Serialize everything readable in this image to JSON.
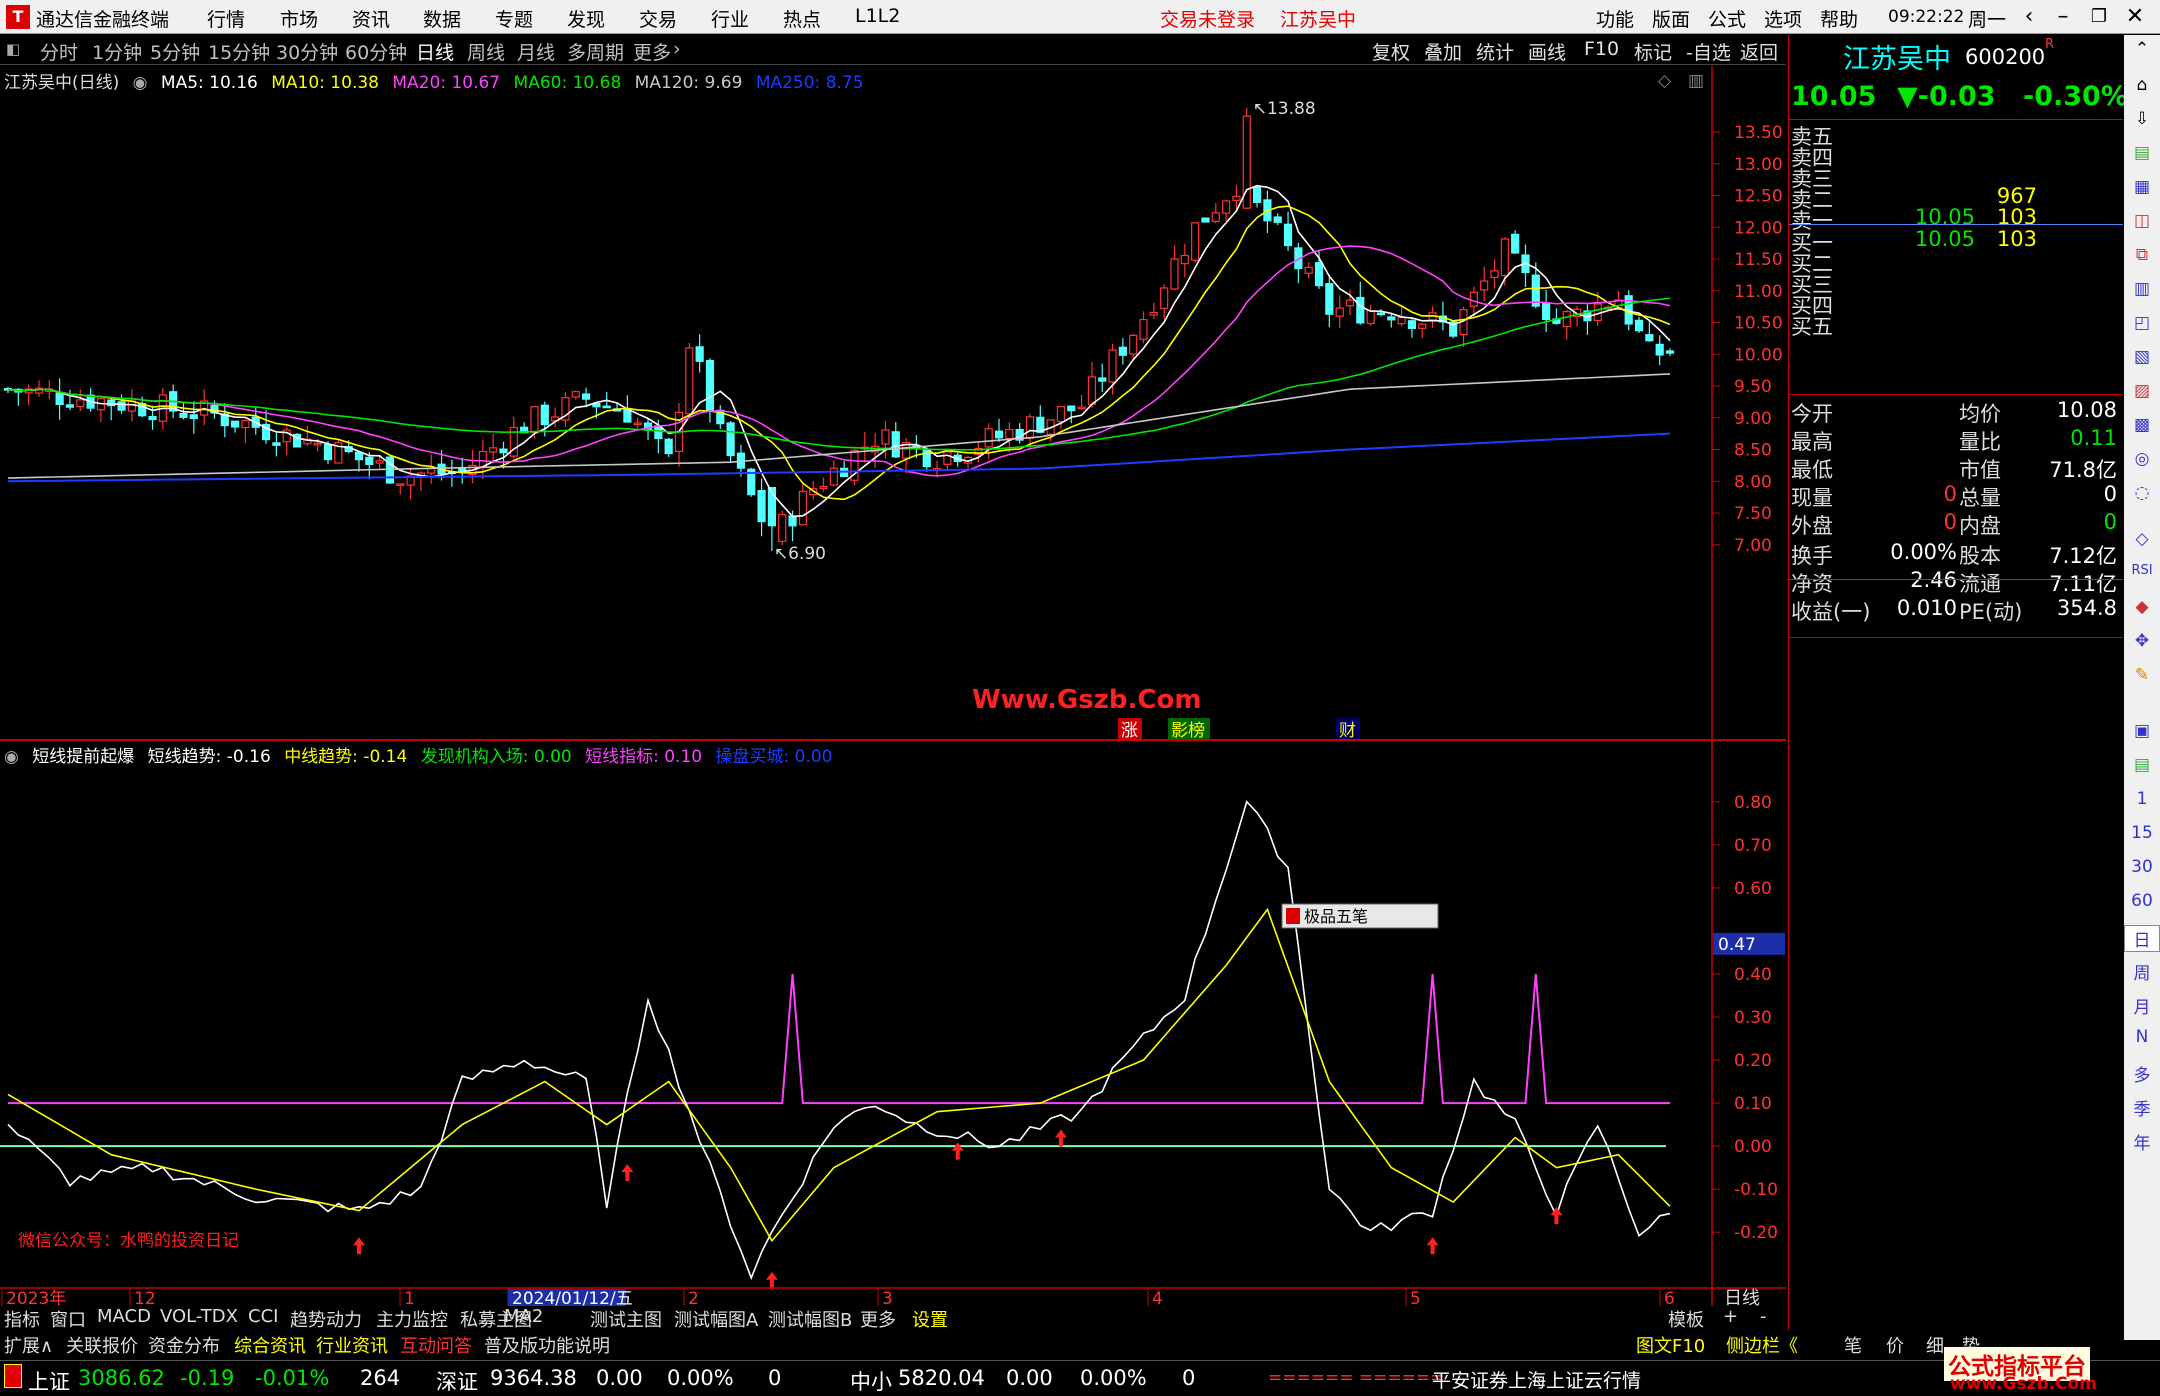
{
  "app": {
    "title": "通达信金融终端",
    "menus": [
      "行情",
      "市场",
      "资讯",
      "数据",
      "专题",
      "发现",
      "交易",
      "行业",
      "热点",
      "L1L2"
    ],
    "trade_status": "交易未登录",
    "stock_name": "江苏吴中",
    "right_menus": [
      "功能",
      "版面",
      "公式",
      "选项",
      "帮助"
    ],
    "clock": "09:22:22",
    "weekday": "周一"
  },
  "periods": [
    "分时",
    "1分钟",
    "5分钟",
    "15分钟",
    "30分钟",
    "60分钟",
    "日线",
    "周线",
    "月线",
    "多周期",
    "更多"
  ],
  "active_period": "日线",
  "chart_tools": [
    "复权",
    "叠加",
    "统计",
    "画线",
    "F10",
    "标记",
    "-自选",
    "返回"
  ],
  "main_legend": {
    "name": "江苏吴中(日线)",
    "items": [
      {
        "label": "MA5: 10.16",
        "color": "#ffffff"
      },
      {
        "label": "MA10: 10.38",
        "color": "#ffff00"
      },
      {
        "label": "MA20: 10.67",
        "color": "#ff40ff"
      },
      {
        "label": "MA60: 10.68",
        "color": "#00e600"
      },
      {
        "label": "MA120: 9.69",
        "color": "#c8c8c8"
      },
      {
        "label": "MA250: 8.75",
        "color": "#1e3cff"
      }
    ]
  },
  "sub_legend": {
    "name": "短线提前起爆",
    "items": [
      {
        "label": "短线趋势: -0.16",
        "color": "#ffffff"
      },
      {
        "label": "中线趋势: -0.14",
        "color": "#ffff00"
      },
      {
        "label": "发现机构入场: 0.00",
        "color": "#00e600"
      },
      {
        "label": "短线指标: 0.10",
        "color": "#ff40ff"
      },
      {
        "label": "操盘买城: 0.00",
        "color": "#1e3cff"
      }
    ]
  },
  "chart_data": [
    {
      "type": "candlestick",
      "title": "江苏吴中(日线)",
      "ylim": [
        6.7,
        13.8
      ],
      "yticks": [
        7.0,
        7.5,
        8.0,
        8.5,
        9.0,
        9.5,
        10.0,
        10.5,
        11.0,
        11.5,
        12.0,
        12.5,
        13.0,
        13.5
      ],
      "x_labels": [
        "2023年",
        "12",
        "1",
        "2024/01/12/五",
        "2",
        "3",
        "4",
        "5",
        "6"
      ],
      "high_label": "13.88",
      "low_label": "6.90",
      "watermark": "Www.Gszb.Com",
      "markers": [
        "涨",
        "影榜",
        "财"
      ]
    },
    {
      "type": "line",
      "title": "短线提前起爆",
      "ylim": [
        -0.26,
        0.86
      ],
      "yticks": [
        0.8,
        0.7,
        0.6,
        0.4,
        0.3,
        0.2,
        0.1,
        0.0,
        -0.1,
        -0.2
      ],
      "current_value_label": "0.47",
      "note": "微信公众号：水鸭的投资日记",
      "popup_label": "极品五笔"
    }
  ],
  "quote": {
    "name": "江苏吴中",
    "code": "600200",
    "price": "10.05",
    "change": "▼-0.03",
    "pct": "-0.30%",
    "asks": [
      {
        "label": "卖五",
        "p": "",
        "v": ""
      },
      {
        "label": "卖四",
        "p": "",
        "v": ""
      },
      {
        "label": "卖三",
        "p": "",
        "v": ""
      },
      {
        "label": "卖二",
        "p": "",
        "v": "967"
      },
      {
        "label": "卖一",
        "p": "10.05",
        "v": "103"
      }
    ],
    "bids": [
      {
        "label": "买一",
        "p": "10.05",
        "v": "103"
      },
      {
        "label": "买二",
        "p": "",
        "v": ""
      },
      {
        "label": "买三",
        "p": "",
        "v": ""
      },
      {
        "label": "买四",
        "p": "",
        "v": ""
      },
      {
        "label": "买五",
        "p": "",
        "v": ""
      }
    ],
    "stats": [
      [
        "今开",
        "",
        "均价",
        "10.08"
      ],
      [
        "最高",
        "",
        "量比",
        "0.11"
      ],
      [
        "最低",
        "",
        "市值",
        "71.8亿"
      ],
      [
        "现量",
        "0",
        "总量",
        "0"
      ],
      [
        "外盘",
        "0",
        "内盘",
        "0"
      ],
      [
        "换手",
        "0.00%",
        "股本",
        "7.12亿"
      ],
      [
        "净资",
        "2.46",
        "流通",
        "7.11亿"
      ],
      [
        "收益(一)",
        "0.010",
        "PE(动)",
        "354.8"
      ]
    ]
  },
  "sidebar_labels": [
    "1",
    "15",
    "30",
    "60",
    "日",
    "周",
    "月",
    "N",
    "多",
    "季",
    "年"
  ],
  "bottom_tabs": [
    "指标",
    "窗口",
    "MACD",
    "VOL-TDX",
    "CCI",
    "趋势动力",
    "主力监控",
    "私募主图",
    "MA2",
    "测试主图",
    "测试幅图A",
    "测试幅图B",
    "更多",
    "设置"
  ],
  "bottom_tabs_right": [
    "模板",
    "+",
    "-"
  ],
  "period_label": "日线",
  "bottom_tabs2": [
    "扩展∧",
    "关联报价",
    "资金分布",
    "综合资讯",
    "行业资讯",
    "互动问答",
    "普及版功能说明"
  ],
  "bottom_tabs2_right": [
    "图文F10",
    "侧边栏《",
    "笔",
    "价",
    "细",
    "势"
  ],
  "status": {
    "sh": {
      "name": "上证",
      "val": "3086.62",
      "chg": "-0.19",
      "pct": "-0.01%",
      "vol": "264"
    },
    "sz": {
      "name": "深证",
      "val": "9364.38",
      "chg": "0.00",
      "pct": "0.00%",
      "vol": "0"
    },
    "zx": {
      "name": "中小",
      "val": "5820.04",
      "chg": "0.00",
      "pct": "0.00%",
      "vol": "0"
    },
    "bars": "====== ======",
    "feed": "平安证券上海上证云行情",
    "brand": "公式指标平台",
    "brand_url": "www.Gszb.Com"
  }
}
